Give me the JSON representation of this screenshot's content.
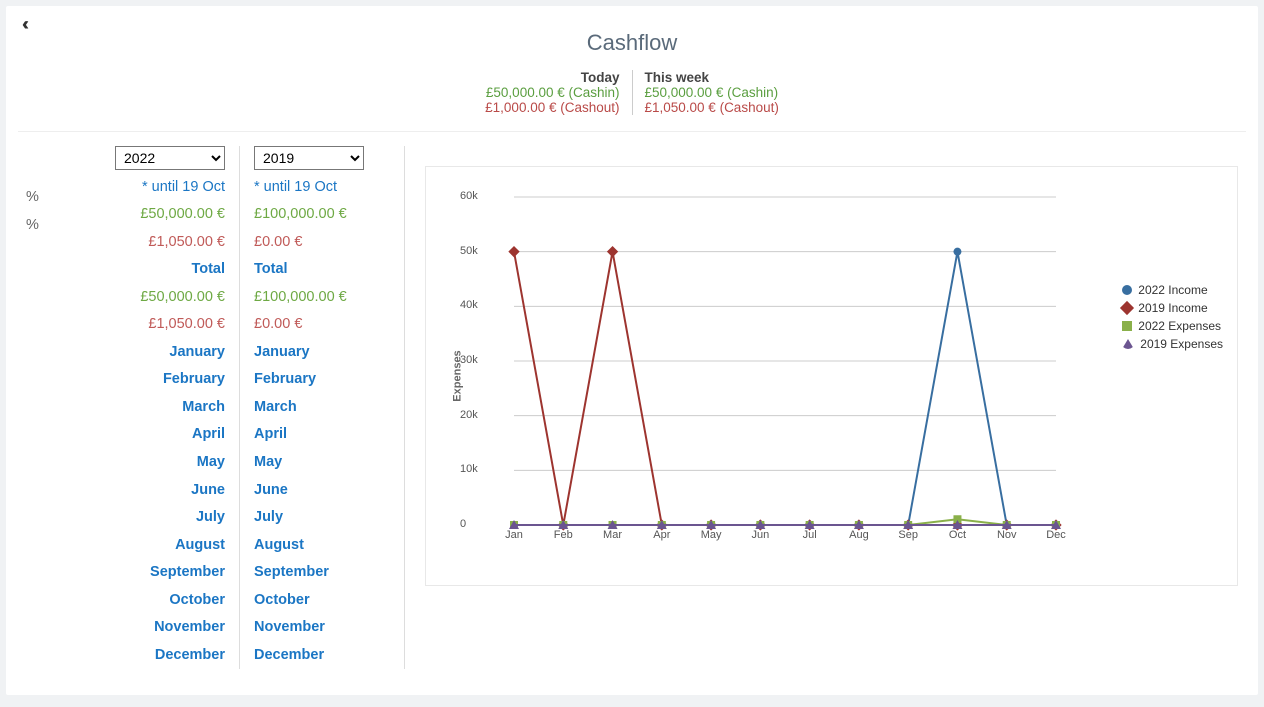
{
  "title": "Cashflow",
  "summary": {
    "today_label": "Today",
    "today_cashin": "£50,000.00 € (Cashin)",
    "today_cashout": "£1,000.00 € (Cashout)",
    "week_label": "This week",
    "week_cashin": "£50,000.00 € (Cashin)",
    "week_cashout": "£1,050.00 € (Cashout)"
  },
  "pct_symbol": "%",
  "columns": [
    {
      "year": "2022",
      "until": "* until 19 Oct",
      "pct_in": "£50,000.00 €",
      "pct_out": "£1,050.00 €",
      "total_label": "Total",
      "total_in": "£50,000.00 €",
      "total_out": "£1,050.00 €"
    },
    {
      "year": "2019",
      "until": "* until 19 Oct",
      "pct_in": "£100,000.00 €",
      "pct_out": "£0.00 €",
      "total_label": "Total",
      "total_in": "£100,000.00 €",
      "total_out": "£0.00 €"
    }
  ],
  "months": [
    "January",
    "February",
    "March",
    "April",
    "May",
    "June",
    "July",
    "August",
    "September",
    "October",
    "November",
    "December"
  ],
  "chart": {
    "ylabel": "Expenses",
    "ylim": [
      0,
      60000
    ],
    "yticks": [
      "0",
      "10k",
      "20k",
      "30k",
      "40k",
      "50k",
      "60k"
    ],
    "legend": [
      "2022 Income",
      "2019 Income",
      "2022 Expenses",
      "2019 Expenses"
    ],
    "colors": {
      "c0": "#386ea0",
      "c1": "#9d342f",
      "c2": "#8ab04a",
      "c3": "#6b5590"
    }
  },
  "chart_data": {
    "type": "line",
    "title": "",
    "xlabel": "",
    "ylabel": "Expenses",
    "ylim": [
      0,
      60000
    ],
    "categories": [
      "Jan",
      "Feb",
      "Mar",
      "Apr",
      "May",
      "Jun",
      "Jul",
      "Aug",
      "Sep",
      "Oct",
      "Nov",
      "Dec"
    ],
    "series": [
      {
        "name": "2022 Income",
        "values": [
          0,
          0,
          0,
          0,
          0,
          0,
          0,
          0,
          0,
          50000,
          0,
          0
        ]
      },
      {
        "name": "2019 Income",
        "values": [
          50000,
          0,
          50000,
          0,
          0,
          0,
          0,
          0,
          0,
          0,
          0,
          0
        ]
      },
      {
        "name": "2022 Expenses",
        "values": [
          0,
          0,
          0,
          0,
          0,
          0,
          0,
          0,
          0,
          1050,
          0,
          0
        ]
      },
      {
        "name": "2019 Expenses",
        "values": [
          0,
          0,
          0,
          0,
          0,
          0,
          0,
          0,
          0,
          0,
          0,
          0
        ]
      }
    ]
  }
}
